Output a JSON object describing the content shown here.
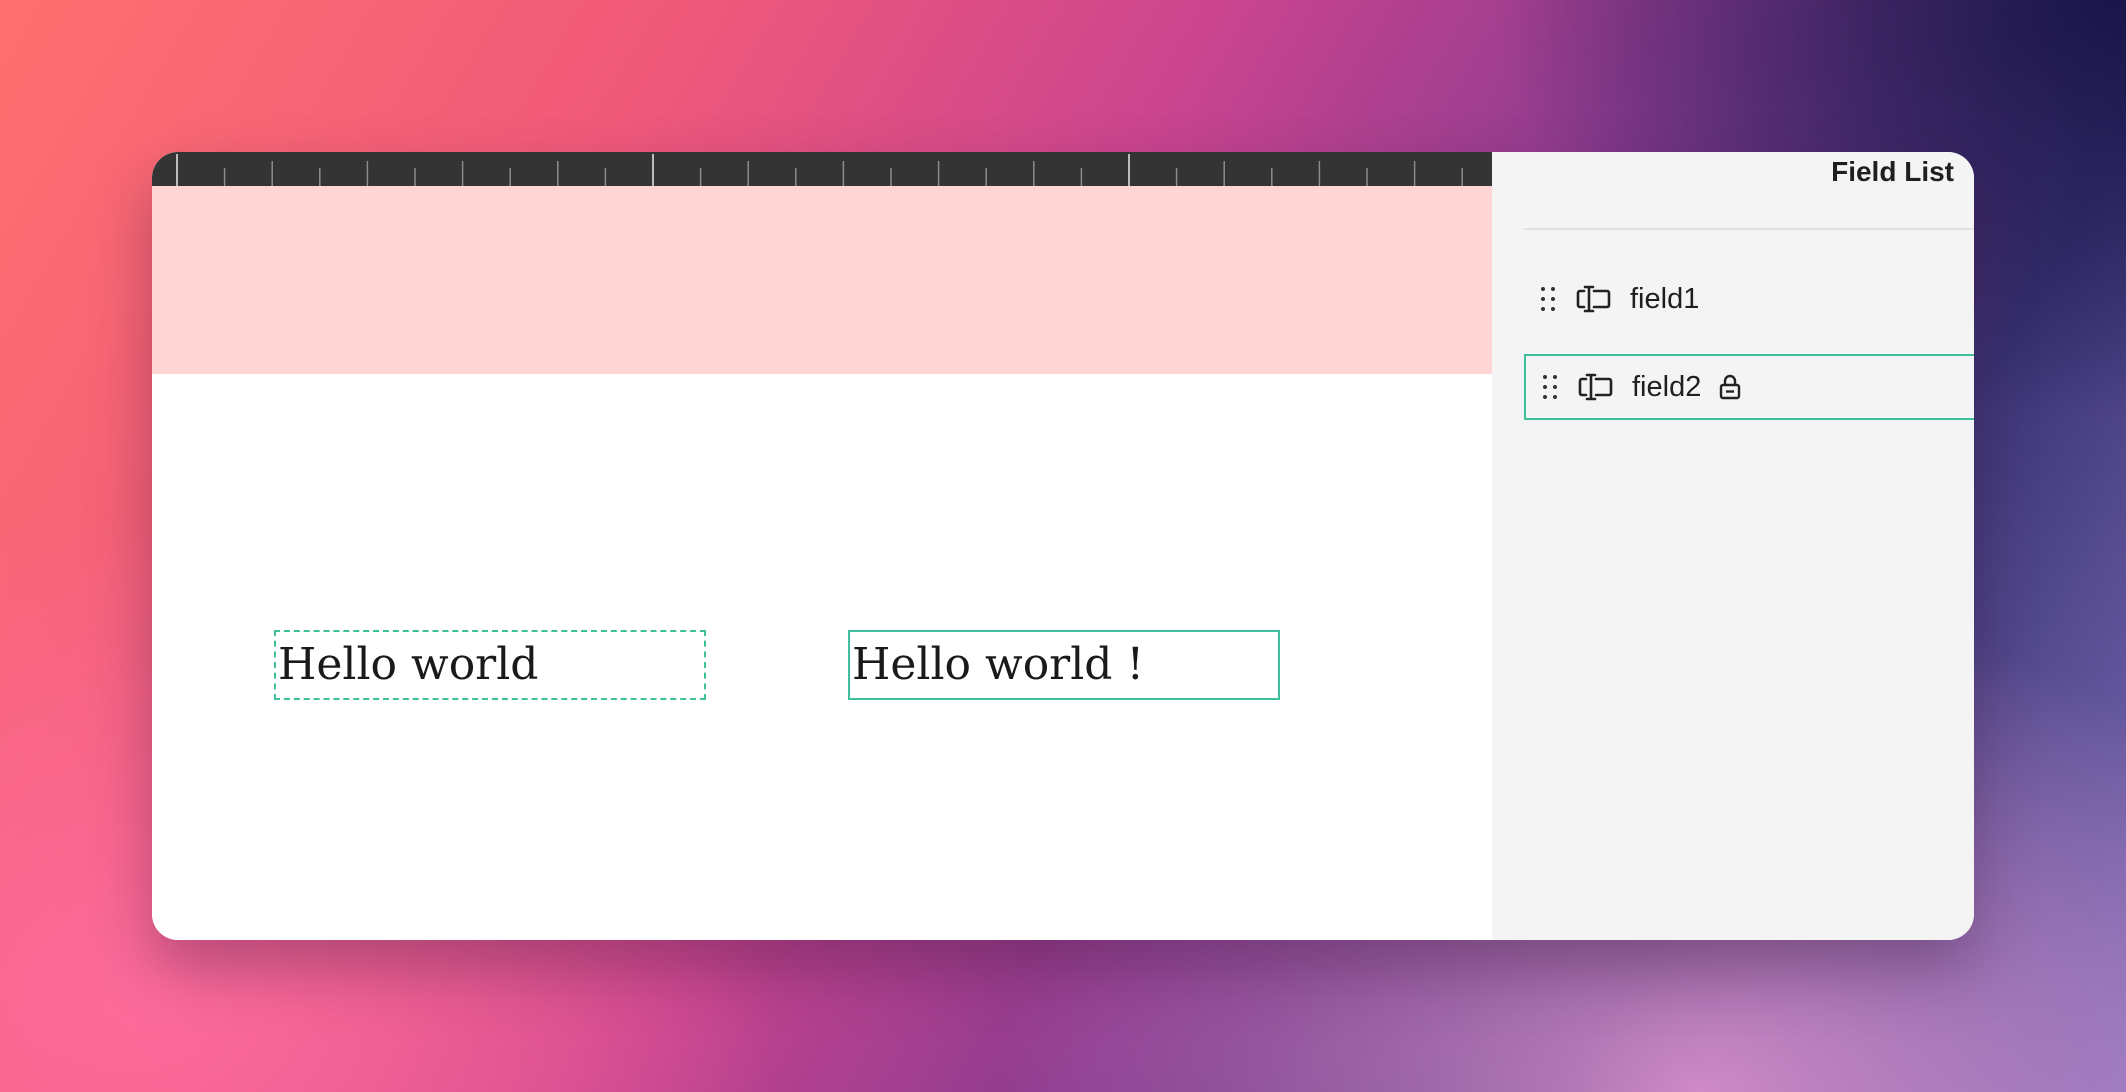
{
  "canvas": {
    "header_band_color": "#ffd4d5",
    "fields": [
      {
        "name": "field1",
        "text": "Hello world",
        "state": "unselected"
      },
      {
        "name": "field2",
        "text": "Hello world !",
        "state": "selected"
      }
    ]
  },
  "sidebar": {
    "title": "Field List",
    "items": [
      {
        "label": "field1",
        "icons": [
          "drag-handle-icon",
          "text-field-icon"
        ],
        "locked": false
      },
      {
        "label": "field2",
        "icons": [
          "drag-handle-icon",
          "text-field-icon",
          "lock-icon"
        ],
        "locked": true,
        "selected": true
      }
    ]
  },
  "colors": {
    "accent": "#3fbf9c",
    "ruler": "#343434",
    "sidebar_bg": "#f4f4f4"
  }
}
